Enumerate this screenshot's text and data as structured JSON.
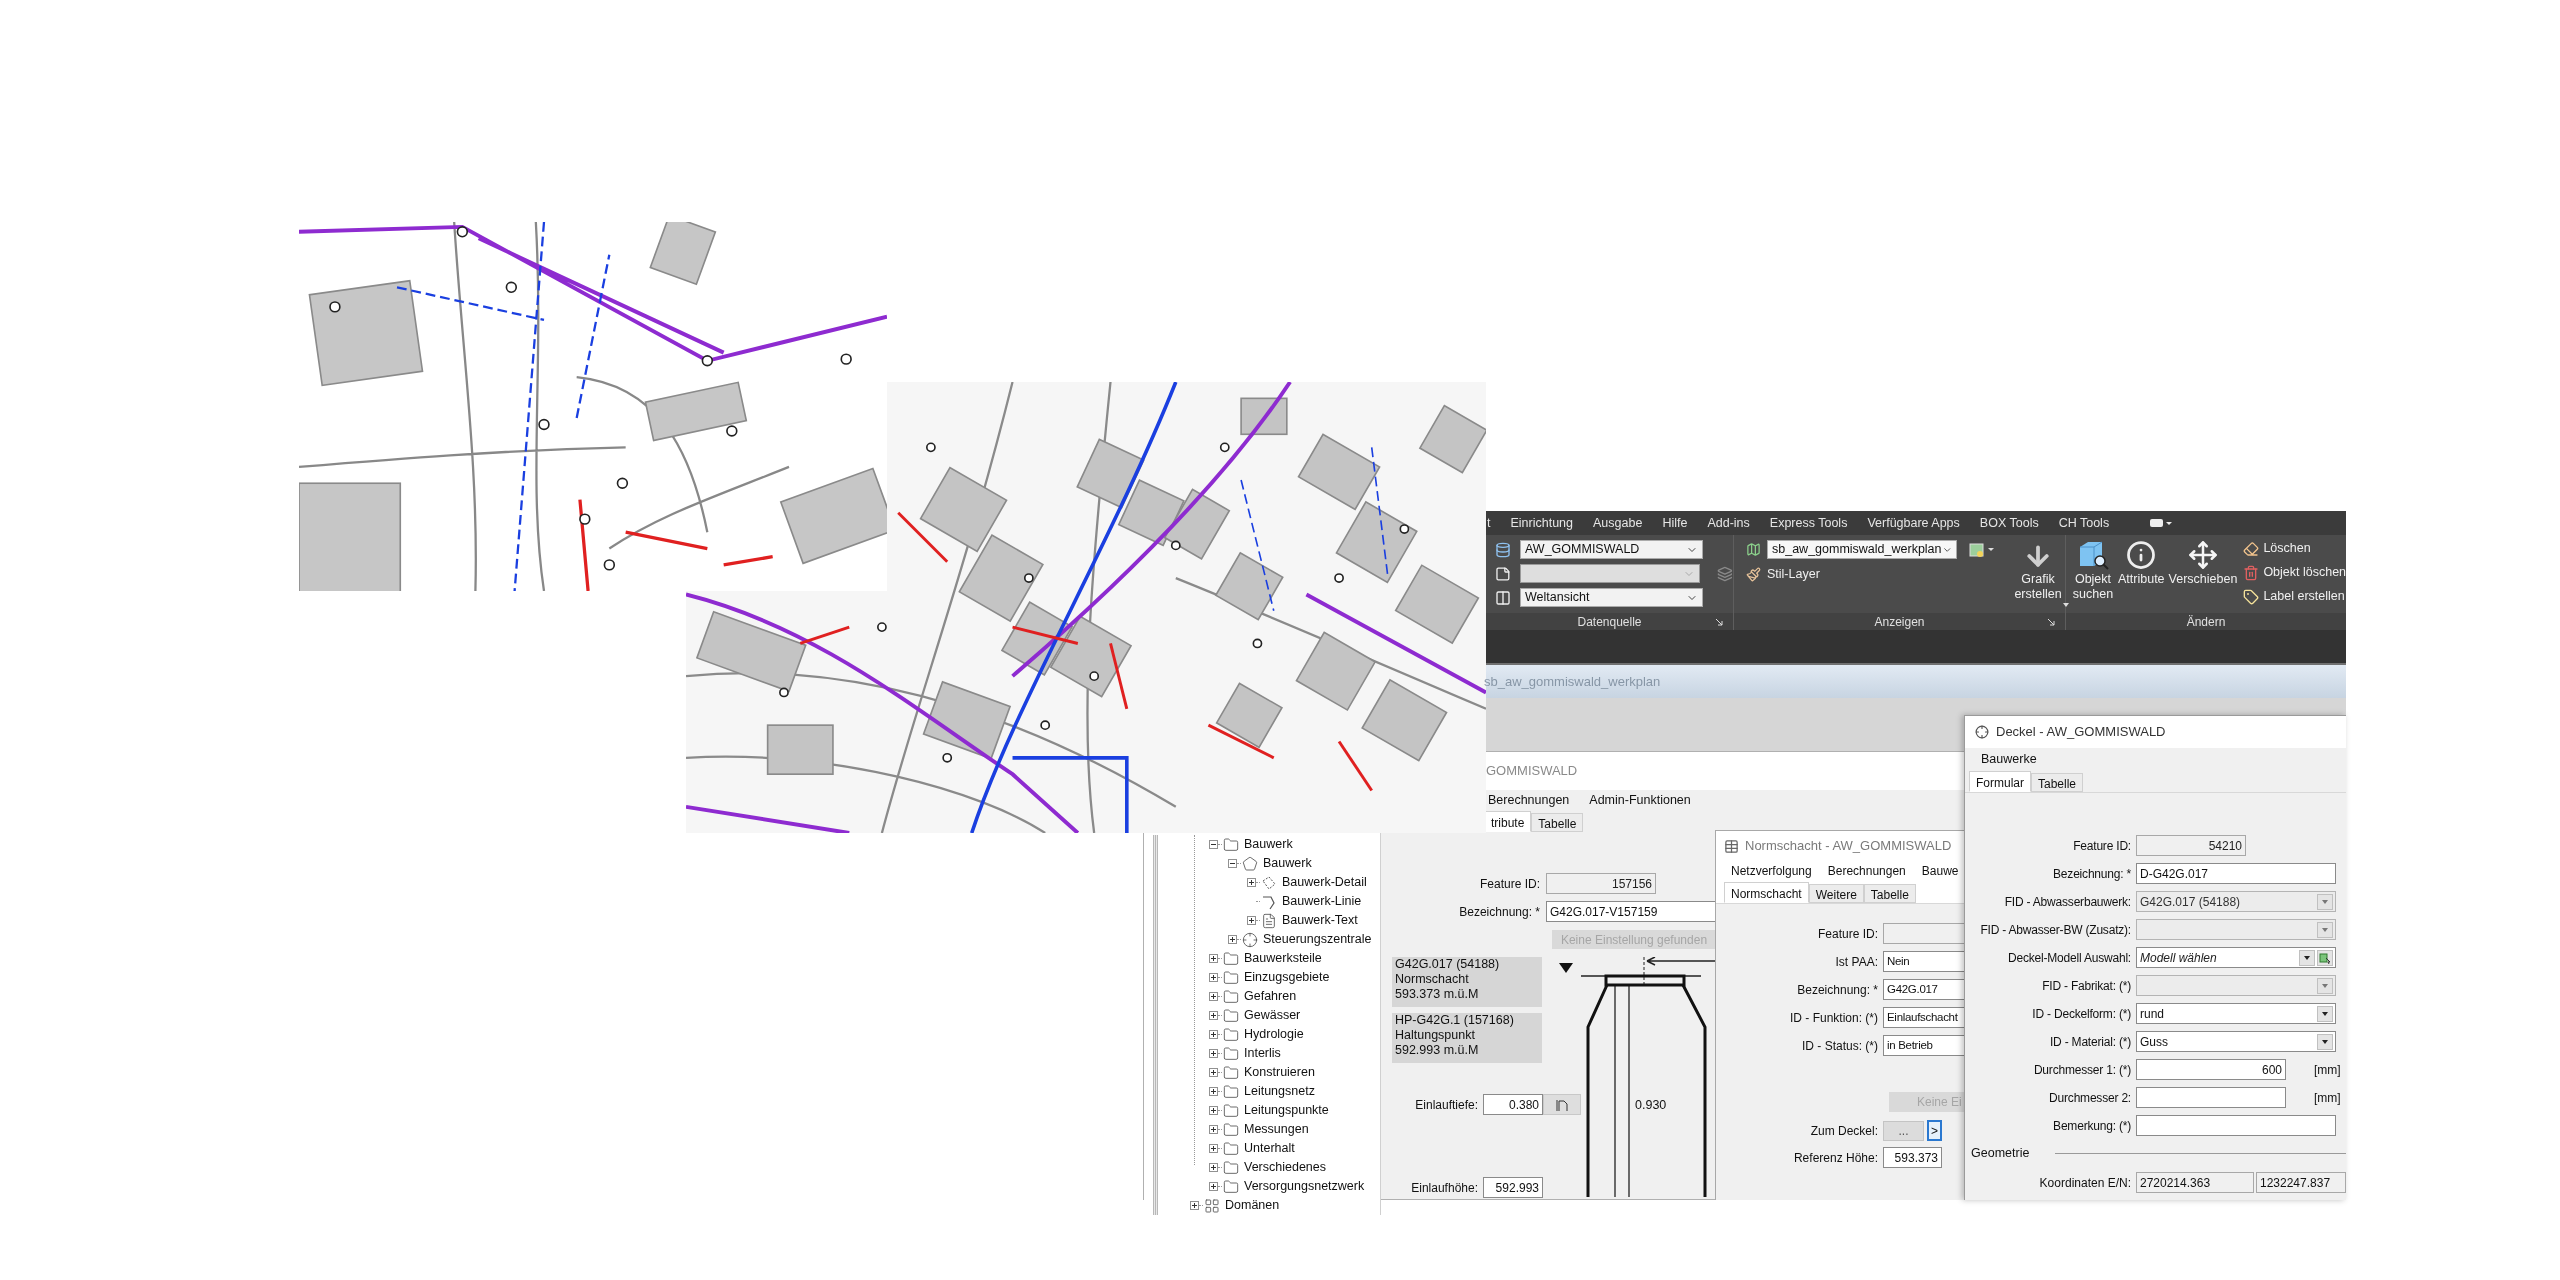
{
  "ribbon": {
    "menu": [
      "t",
      "Einrichtung",
      "Ausgabe",
      "Hilfe",
      "Add-ins",
      "Express Tools",
      "Verfügbare Apps",
      "BOX Tools",
      "CH Tools"
    ],
    "datenquelle": {
      "label": "Datenquelle",
      "combos": [
        {
          "kind": "database",
          "value": "AW_GOMMISWALD",
          "disabled": false
        },
        {
          "kind": "page",
          "disabled": true
        },
        {
          "kind": "view",
          "value": "Weltansicht",
          "disabled": false
        }
      ]
    },
    "anzeigen": {
      "label": "Anzeigen",
      "layer_combo": "sb_aw_gommiswald_werkplan",
      "style_button": "Stil-Layer",
      "create_button": "Grafik erstellen"
    },
    "aendern": {
      "label": "Ändern",
      "large_buttons": [
        {
          "kind": "search",
          "label": "Objekt suchen"
        },
        {
          "kind": "info",
          "label": "Attribute"
        },
        {
          "kind": "move",
          "label": "Verschieben"
        }
      ],
      "small_buttons": [
        {
          "kind": "erase",
          "label": "Löschen"
        },
        {
          "kind": "delete",
          "label": "Objekt löschen"
        },
        {
          "kind": "label",
          "label": "Label erstellen"
        }
      ]
    }
  },
  "drawing_window": {
    "title": "sb_aw_gommiswald_werkplan"
  },
  "bauwerk_dialog": {
    "title": "GOMMISWALD",
    "menu": [
      "Berechnungen",
      "Admin-Funktionen"
    ],
    "tabs": [
      {
        "label": "tribute",
        "selected": true
      },
      {
        "label": "Tabelle",
        "selected": false
      }
    ],
    "tree": [
      {
        "expanded": true,
        "children": [
          {
            "label": "Bauwerk",
            "kind": "folder",
            "expanded": true,
            "children": [
              {
                "label": "Bauwerk",
                "kind": "polygon",
                "expanded": true,
                "children": [
                  {
                    "label": "Bauwerk-Detail",
                    "kind": "detail",
                    "expanded": false
                  },
                  {
                    "label": "Bauwerk-Linie",
                    "kind": "line"
                  },
                  {
                    "label": "Bauwerk-Text",
                    "kind": "text",
                    "expanded": false
                  }
                ]
              },
              {
                "label": "Steuerungszentrale",
                "kind": "point",
                "expanded": false
              }
            ]
          },
          {
            "label": "Bauwerksteile",
            "kind": "folder",
            "expanded": false
          },
          {
            "label": "Einzugsgebiete",
            "kind": "folder",
            "expanded": false
          },
          {
            "label": "Gefahren",
            "kind": "folder",
            "expanded": false
          },
          {
            "label": "Gewässer",
            "kind": "folder",
            "expanded": false
          },
          {
            "label": "Hydrologie",
            "kind": "folder",
            "expanded": false
          },
          {
            "label": "Interlis",
            "kind": "folder",
            "expanded": false
          },
          {
            "label": "Konstruieren",
            "kind": "folder",
            "expanded": false
          },
          {
            "label": "Leitungsnetz",
            "kind": "folder",
            "expanded": false
          },
          {
            "label": "Leitungspunkte",
            "kind": "folder",
            "expanded": false
          },
          {
            "label": "Messungen",
            "kind": "folder",
            "expanded": false
          },
          {
            "label": "Unterhalt",
            "kind": "folder",
            "expanded": false
          },
          {
            "label": "Verschiedenes",
            "kind": "folder",
            "expanded": false
          },
          {
            "label": "Versorgungsnetzwerk",
            "kind": "folder",
            "expanded": false
          }
        ]
      },
      {
        "label": "Domänen",
        "kind": "domain",
        "expanded": false
      }
    ],
    "fields": [
      {
        "label": "Feature ID:",
        "kind": "readonly",
        "value": "157156"
      },
      {
        "label": "Bezeichnung: *",
        "kind": "text",
        "value": "G42G.017-V157159"
      }
    ],
    "settings_button": {
      "label": "Keine Einstellung gefunden",
      "disabled": true
    },
    "info_boxes": [
      {
        "lines": [
          "G42G.017 (54188)",
          "Normschacht",
          "593.373 m.ü.M"
        ]
      },
      {
        "lines": [
          "HP-G42G.1 (157168)",
          "Haltungspunkt",
          "592.993 m.ü.M"
        ]
      }
    ],
    "height_label": "0.930",
    "depth_fields": [
      {
        "kind": "with_button",
        "label": "Einlauftiefe:",
        "value": "0.380"
      },
      {
        "kind": "plain",
        "label": "Einlaufhöhe:",
        "value": "592.993"
      }
    ]
  },
  "normschacht_dialog": {
    "title": "Normschacht - AW_GOMMISWALD",
    "menu": [
      "Netzverfolgung",
      "Berechnungen",
      "Bauwe"
    ],
    "tabs": [
      {
        "label": "Normschacht",
        "selected": true
      },
      {
        "label": "Weitere",
        "selected": false
      },
      {
        "label": "Tabelle",
        "selected": false
      }
    ],
    "fields": [
      {
        "label": "Feature ID:",
        "kind": "readonly"
      },
      {
        "label": "Ist PAA:",
        "kind": "text",
        "value": "Nein"
      },
      {
        "label": "Bezeichnung: *",
        "kind": "text",
        "value": "G42G.017"
      },
      {
        "label": "ID - Funktion: (*)",
        "kind": "text",
        "value": "Einlaufschacht"
      },
      {
        "label": "ID - Status: (*)",
        "kind": "text",
        "value": "in Betrieb"
      }
    ],
    "settings_button": {
      "label": "Keine Ei",
      "disabled": true
    },
    "link_field": {
      "label": "Zum Deckel:",
      "button": "...",
      "go_button": ">"
    },
    "height_field": {
      "label": "Referenz Höhe:",
      "value": "593.373"
    }
  },
  "deckel_dialog": {
    "title": "Deckel - AW_GOMMISWALD",
    "menu": [
      "Bauwerke"
    ],
    "tabs": [
      {
        "label": "Formular",
        "selected": true
      },
      {
        "label": "Tabelle",
        "selected": false
      }
    ],
    "fields": [
      {
        "label": "Feature ID:",
        "kind": "readonly",
        "value": "54210"
      },
      {
        "label": "Bezeichnung: *",
        "kind": "text",
        "value": "D-G42G.017"
      },
      {
        "label": "FID - Abwasserbauwerk:",
        "kind": "combo",
        "value": "G42G.017 (54188)",
        "disabled": true
      },
      {
        "label": "FID - Abwasser-BW (Zusatz):",
        "kind": "combo",
        "disabled": true
      },
      {
        "label": "Deckel-Modell Auswahl:",
        "kind": "picker",
        "placeholder": "Modell wählen"
      },
      {
        "label": "FID - Fabrikat: (*)",
        "kind": "combo",
        "disabled": true
      },
      {
        "label": "ID - Deckelform: (*)",
        "kind": "combo",
        "value": "rund",
        "disabled": false
      },
      {
        "label": "ID - Material: (*)",
        "kind": "combo",
        "value": "Guss",
        "disabled": false
      },
      {
        "label": "Durchmesser 1: (*)",
        "kind": "number",
        "value": "600",
        "unit": "[mm]"
      },
      {
        "label": "Durchmesser 2:",
        "kind": "number",
        "unit": "[mm]"
      },
      {
        "label": "Bemerkung: (*)",
        "kind": "text"
      }
    ],
    "section": "Geometrie",
    "coordinates": {
      "label": "Koordinaten E/N:",
      "east": "2720214.363",
      "north": "1232247.837"
    }
  }
}
